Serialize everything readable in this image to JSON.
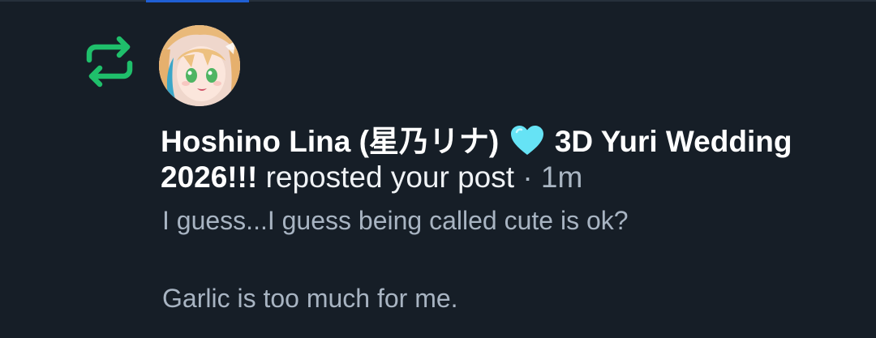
{
  "notification": {
    "type_icon": "repost-icon",
    "author": {
      "display_name": "Hoshino Lina (星乃リナ)",
      "name_emoji": "light-blue-heart",
      "display_name_suffix": "3D Yuri Wedding 2026!!!"
    },
    "action_text": "reposted your post",
    "time_separator": "·",
    "time": "1m",
    "post_text_line1": "I guess...I guess being called cute is ok?",
    "post_text_line2": "Garlic is too much for me."
  },
  "colors": {
    "background": "#161e27",
    "repost_icon": "#1fbf6b",
    "heart": "#66e3f5",
    "primary_text": "#ffffff",
    "secondary_text": "#a8b4c2",
    "tab_indicator": "#1f5fd4"
  }
}
